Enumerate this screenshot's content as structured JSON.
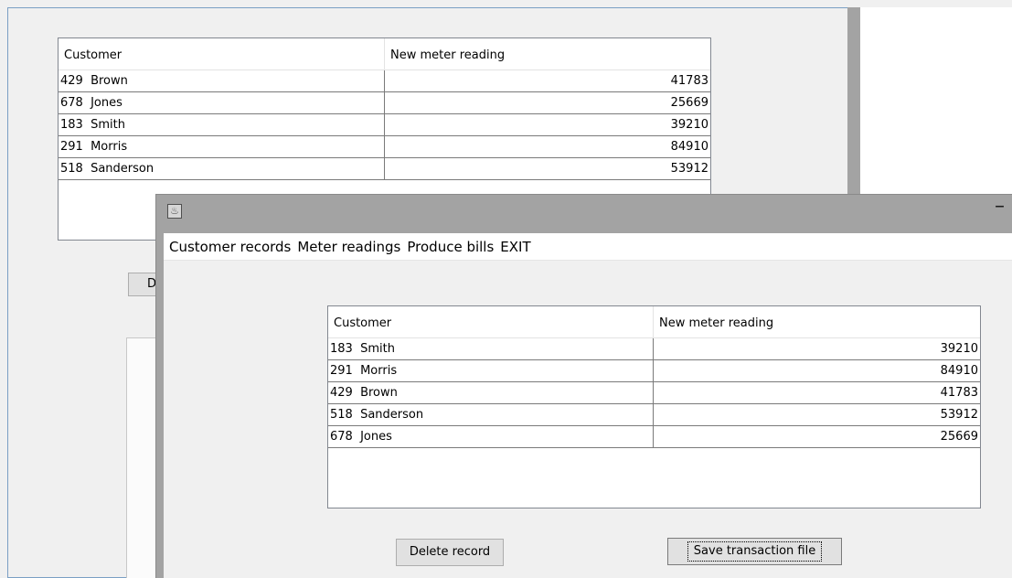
{
  "background_window": {
    "table": {
      "columns": [
        "Customer",
        "New meter reading"
      ],
      "rows": [
        {
          "customer": "429  Brown",
          "reading": "41783"
        },
        {
          "customer": "678  Jones",
          "reading": "25669"
        },
        {
          "customer": "183  Smith",
          "reading": "39210"
        },
        {
          "customer": "291  Morris",
          "reading": "84910"
        },
        {
          "customer": "518  Sanderson",
          "reading": "53912"
        }
      ]
    },
    "partial_button_label": "D"
  },
  "foreground_window": {
    "titlebar": {
      "app_icon": "java-cup-icon",
      "minimize_label": "–"
    },
    "menu": [
      "Customer records",
      "Meter readings",
      "Produce bills",
      "EXIT"
    ],
    "table": {
      "columns": [
        "Customer",
        "New meter reading"
      ],
      "rows": [
        {
          "customer": "183  Smith",
          "reading": "39210"
        },
        {
          "customer": "291  Morris",
          "reading": "84910"
        },
        {
          "customer": "429  Brown",
          "reading": "41783"
        },
        {
          "customer": "518  Sanderson",
          "reading": "53912"
        },
        {
          "customer": "678  Jones",
          "reading": "25669"
        }
      ]
    },
    "buttons": {
      "delete": "Delete record",
      "save": "Save transaction file"
    }
  }
}
